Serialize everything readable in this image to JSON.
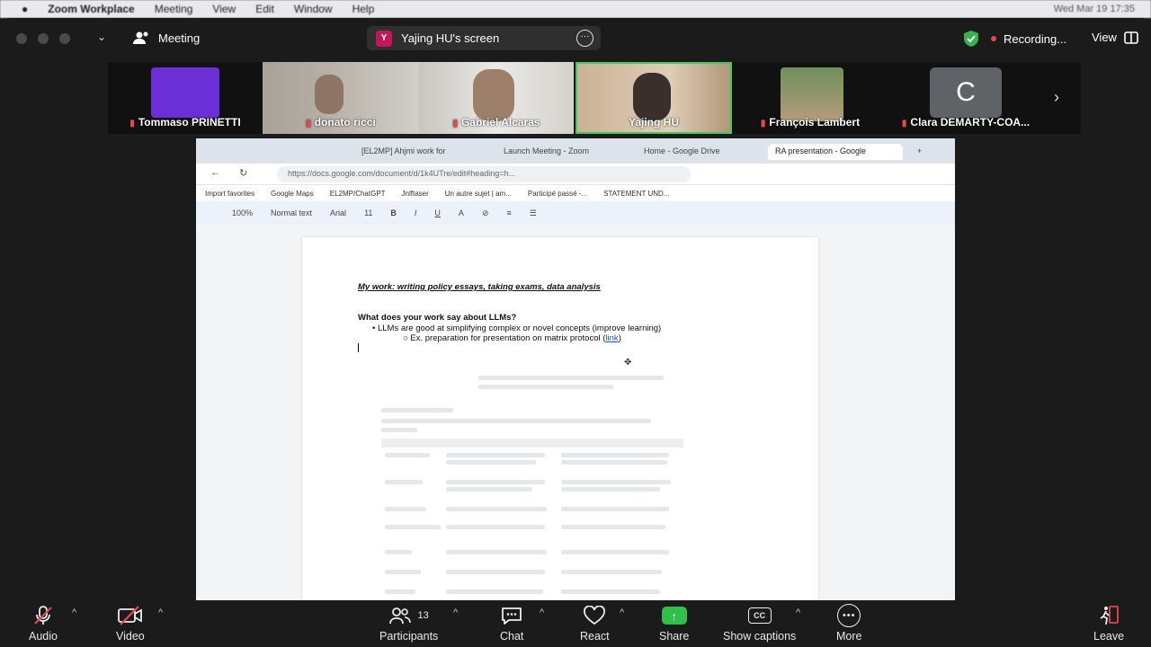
{
  "menubar": {
    "app": "Zoom Workplace",
    "items": [
      "Meeting",
      "View",
      "Edit",
      "Window",
      "Help"
    ],
    "clock": "Wed Mar 19 17:35"
  },
  "titlebar": {
    "meeting": "Meeting",
    "screen_share": "Yajing HU's screen",
    "share_initial": "Y",
    "recording": "Recording...",
    "view": "View"
  },
  "participants": [
    {
      "name": "Tommaso PRINETTI",
      "muted": true
    },
    {
      "name": "donato ricci",
      "muted": true
    },
    {
      "name": "Gabriel Alcaras",
      "muted": true
    },
    {
      "name": "Yajing HU",
      "muted": false
    },
    {
      "name": "François Lambert",
      "muted": true
    },
    {
      "name": "Clara DEMARTY-COA...",
      "muted": true,
      "initial": "C"
    }
  ],
  "browser": {
    "tabs": [
      "[EL2MP] Ahjmi work for",
      "Launch Meeting - Zoom",
      "Home - Google Drive",
      "RA presentation - Google"
    ],
    "url": "https://docs.google.com/document/d/1k4UTre/edit#heading=h...",
    "bookmarks": [
      "Import favorites",
      "Google Maps",
      "EL2MP/ChatGPT",
      "Jnlftaser",
      "Un autre sujet | am...",
      "Participé passé -...",
      "STATEMENT UND..."
    ],
    "toolbar": {
      "zoom": "100%",
      "style": "Normal text",
      "font": "Arial",
      "size": "11"
    }
  },
  "doc": {
    "heading": "My work: writing policy essays, taking exams, data analysis",
    "question": "What does your work say about LLMs?",
    "bullet1": "LLMs are good at simplifying complex or novel concepts (improve learning)",
    "bullet2": "Ex. preparation for presentation on matrix protocol (",
    "bullet2_link": "link",
    "bullet2_end": ")"
  },
  "controls": {
    "audio": "Audio",
    "video": "Video",
    "participants": "Participants",
    "participants_count": "13",
    "chat": "Chat",
    "react": "React",
    "share": "Share",
    "captions": "Show captions",
    "more": "More",
    "leave": "Leave"
  },
  "colors": {
    "recording": "#e5484d",
    "share_green": "#2fbf4a",
    "selected_tile": "#3ecb5c",
    "shield": "#36b34a"
  }
}
